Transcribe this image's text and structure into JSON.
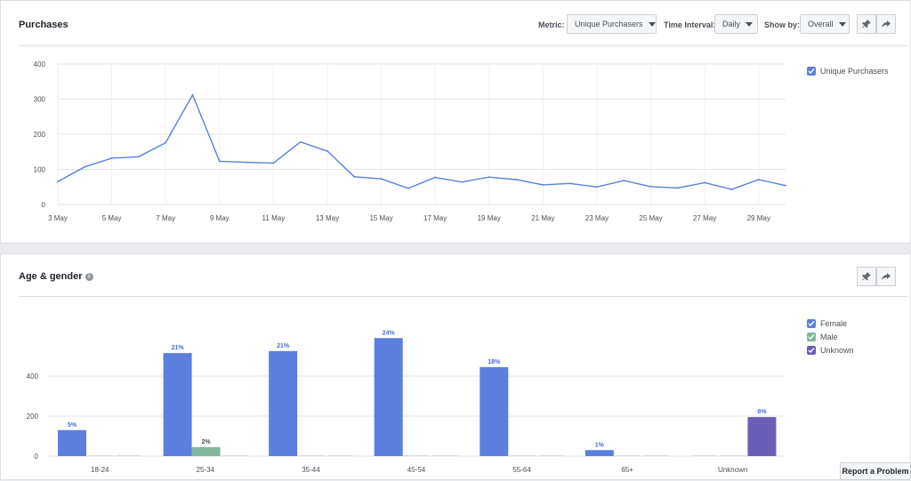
{
  "purchases": {
    "title": "Purchases",
    "controls": {
      "metric_label": "Metric:",
      "metric_value": "Unique Purchasers",
      "interval_label": "Time Interval:",
      "interval_value": "Daily",
      "showby_label": "Show by:",
      "showby_value": "Overall"
    },
    "legend": [
      {
        "label": "Unique Purchasers",
        "color": "#5b7fde"
      }
    ]
  },
  "age_gender": {
    "title": "Age & gender",
    "info_icon": "i",
    "legend": [
      {
        "label": "Female",
        "color": "#5b7fde"
      },
      {
        "label": "Male",
        "color": "#7fb89a"
      },
      {
        "label": "Unknown",
        "color": "#6b5fb5"
      }
    ]
  },
  "report_button": "Report a Problem",
  "icons": [
    "pin-icon",
    "share-icon",
    "info-icon",
    "caret-down-icon",
    "checkbox-icon"
  ],
  "chart_data": [
    {
      "type": "line",
      "x": [
        "3 May",
        "4 May",
        "5 May",
        "6 May",
        "7 May",
        "8 May",
        "9 May",
        "10 May",
        "11 May",
        "12 May",
        "13 May",
        "14 May",
        "15 May",
        "16 May",
        "17 May",
        "18 May",
        "19 May",
        "20 May",
        "21 May",
        "22 May",
        "23 May",
        "24 May",
        "25 May",
        "26 May",
        "27 May",
        "28 May",
        "29 May",
        "30 May"
      ],
      "xticks": [
        "3 May",
        "5 May",
        "7 May",
        "9 May",
        "11 May",
        "13 May",
        "15 May",
        "17 May",
        "19 May",
        "21 May",
        "23 May",
        "25 May",
        "27 May",
        "29 May"
      ],
      "series": [
        {
          "name": "Unique Purchasers",
          "values": [
            65,
            107,
            132,
            136,
            176,
            312,
            123,
            120,
            118,
            178,
            152,
            79,
            73,
            46,
            77,
            64,
            78,
            71,
            56,
            60,
            50,
            68,
            51,
            47,
            62,
            43,
            71,
            54
          ]
        }
      ],
      "ylim": [
        0,
        400
      ],
      "yticks": [
        0,
        100,
        200,
        300,
        400
      ],
      "grid": true,
      "legend": "top-right"
    },
    {
      "type": "bar",
      "categories": [
        "18-24",
        "25-34",
        "35-44",
        "45-54",
        "55-64",
        "65+",
        "Unknown"
      ],
      "series": [
        {
          "name": "Female",
          "values": [
            130,
            515,
            525,
            590,
            445,
            30,
            0
          ],
          "labels": [
            "5%",
            "21%",
            "21%",
            "24%",
            "18%",
            "1%",
            ""
          ]
        },
        {
          "name": "Male",
          "values": [
            0,
            45,
            0,
            0,
            0,
            0,
            0
          ],
          "labels": [
            "",
            "2%",
            "",
            "",
            "",
            "",
            ""
          ]
        },
        {
          "name": "Unknown",
          "values": [
            0,
            0,
            0,
            0,
            0,
            0,
            195
          ],
          "labels": [
            "",
            "",
            "",
            "",
            "",
            "",
            "6%"
          ]
        }
      ],
      "ylim": [
        0,
        600
      ],
      "yticks": [
        0,
        200,
        400
      ],
      "grid": true,
      "legend": "top-right"
    }
  ]
}
